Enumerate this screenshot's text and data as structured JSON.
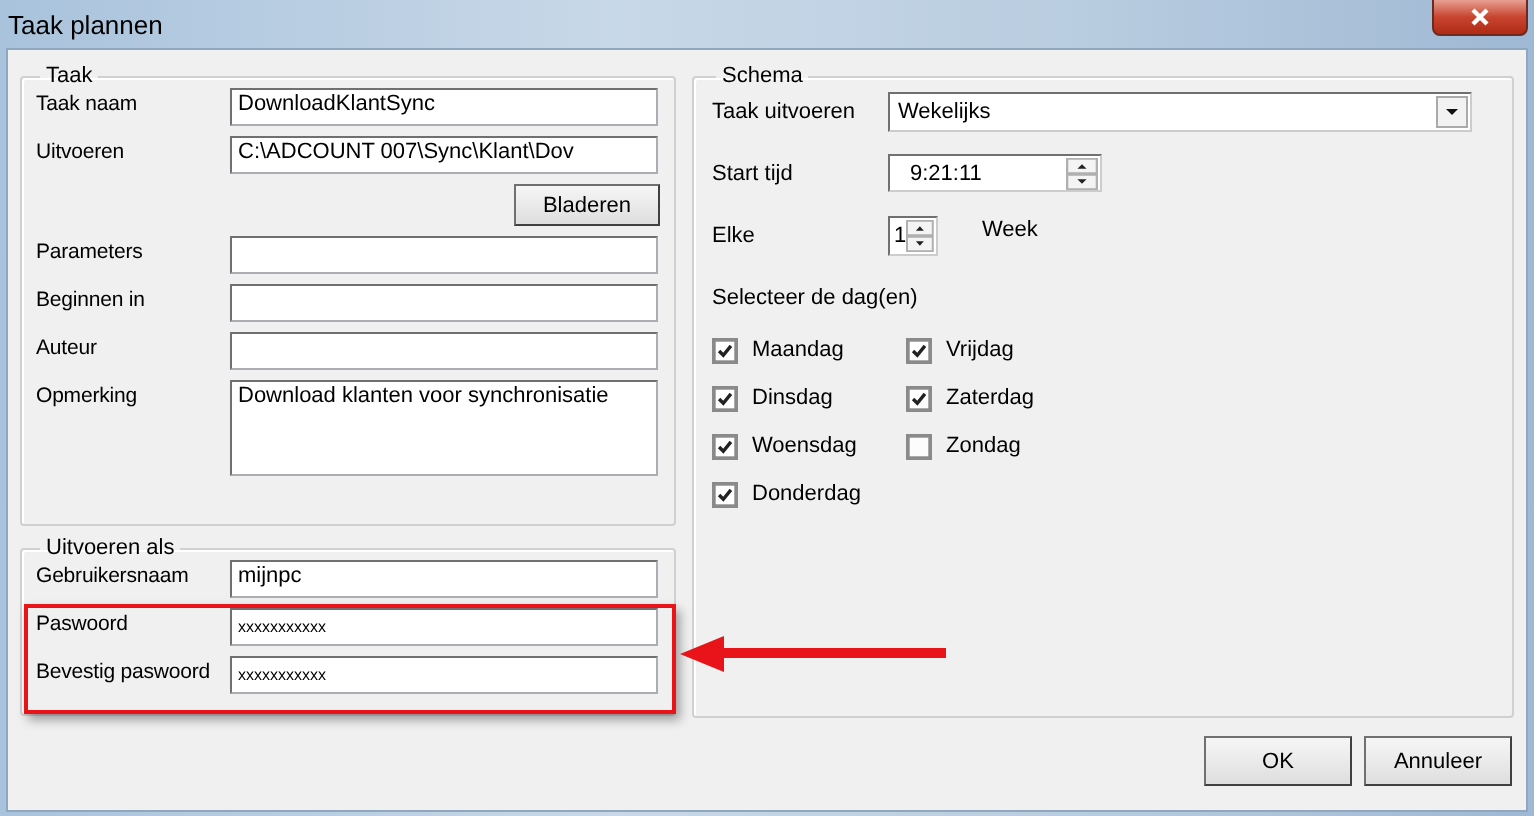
{
  "window": {
    "title": "Taak plannen"
  },
  "taak": {
    "title": "Taak",
    "items": [
      {
        "kind": "field",
        "label": "Taak naam",
        "value": "DownloadKlantSync"
      },
      {
        "kind": "field",
        "label": "Uitvoeren",
        "value": "C:\\ADCOUNT 007\\Sync\\Klant\\Dov"
      },
      {
        "kind": "button",
        "label": "Bladeren"
      },
      {
        "kind": "field",
        "label": "Parameters"
      },
      {
        "kind": "field",
        "label": "Beginnen in"
      },
      {
        "kind": "field",
        "label": "Auteur"
      },
      {
        "kind": "multiline",
        "label": "Opmerking",
        "value": "Download klanten voor synchronisatie"
      }
    ]
  },
  "run_as": {
    "title": "Uitvoeren als",
    "items": [
      {
        "kind": "field",
        "label": "Gebruikersnaam",
        "value": "mijnpc"
      },
      {
        "kind": "password",
        "label": "Paswoord",
        "value": "xxxxxxxxxxx"
      },
      {
        "kind": "password",
        "label": "Bevestig paswoord",
        "value": "xxxxxxxxxxx"
      }
    ]
  },
  "schema": {
    "title": "Schema",
    "run_label": "Taak uitvoeren",
    "run_value": "Wekelijks",
    "start_label": "Start tijd",
    "start_value": "9:21:11",
    "every_label": "Elke",
    "every_value": "1",
    "every_unit": "Week",
    "days_label": "Selecteer de dag(en)",
    "days": [
      {
        "label": "Maandag",
        "checked": true
      },
      {
        "label": "Dinsdag",
        "checked": true
      },
      {
        "label": "Woensdag",
        "checked": true
      },
      {
        "label": "Donderdag",
        "checked": true
      },
      {
        "label": "Vrijdag",
        "checked": true
      },
      {
        "label": "Zaterdag",
        "checked": true
      },
      {
        "label": "Zondag",
        "checked": false
      }
    ]
  },
  "buttons": [
    "OK",
    "Annuleer"
  ]
}
